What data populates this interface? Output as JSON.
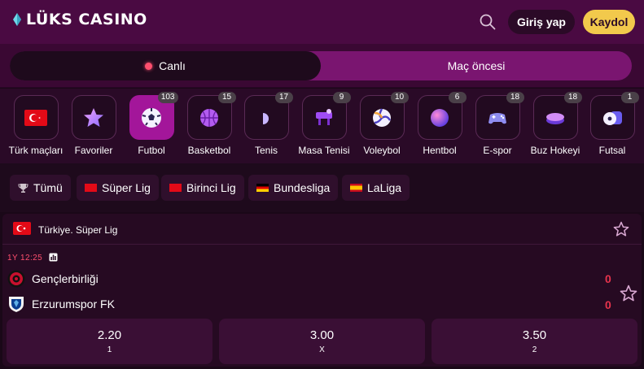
{
  "header": {
    "logo_text": "LÜKS CASINO",
    "login_label": "Giriş yap",
    "register_label": "Kaydol"
  },
  "tabs": [
    {
      "label": "Canlı",
      "active": true
    },
    {
      "label": "Maç öncesi",
      "active": false
    }
  ],
  "sports": [
    {
      "label": "Türk maçları",
      "count": "",
      "icon": "turkey-flag-icon"
    },
    {
      "label": "Favoriler",
      "count": "",
      "icon": "star-icon"
    },
    {
      "label": "Futbol",
      "count": "103",
      "icon": "football-icon",
      "active": true
    },
    {
      "label": "Basketbol",
      "count": "15",
      "icon": "basketball-icon"
    },
    {
      "label": "Tenis",
      "count": "17",
      "icon": "tennis-icon"
    },
    {
      "label": "Masa Tenisi",
      "count": "9",
      "icon": "table-tennis-icon"
    },
    {
      "label": "Voleybol",
      "count": "10",
      "icon": "volleyball-icon"
    },
    {
      "label": "Hentbol",
      "count": "6",
      "icon": "handball-icon"
    },
    {
      "label": "E-spor",
      "count": "18",
      "icon": "gamepad-icon"
    },
    {
      "label": "Buz Hokeyi",
      "count": "18",
      "icon": "hockey-puck-icon"
    },
    {
      "label": "Futsal",
      "count": "1",
      "icon": "futsal-icon"
    }
  ],
  "leagues": [
    {
      "label": "Tümü",
      "icon": "trophy-icon"
    },
    {
      "label": "Süper Lig",
      "icon": "turkey-flag-icon"
    },
    {
      "label": "Birinci Lig",
      "icon": "turkey-flag-icon"
    },
    {
      "label": "Bundesliga",
      "icon": "germany-flag-icon"
    },
    {
      "label": "LaLiga",
      "icon": "spain-flag-icon"
    }
  ],
  "match": {
    "league": "Türkiye. Süper Lig",
    "time": "1Y 12:25",
    "home": {
      "name": "Gençlerbirliği",
      "score": "0"
    },
    "away": {
      "name": "Erzurumspor FK",
      "score": "0"
    },
    "odds": [
      {
        "value": "2.20",
        "label": "1"
      },
      {
        "value": "3.00",
        "label": "X"
      },
      {
        "value": "3.50",
        "label": "2"
      }
    ]
  },
  "colors": {
    "header_bg": "#4a0a42",
    "accent": "#a3169a",
    "register_bg": "#f2c94c",
    "live": "#ff4f6e",
    "score": "#e6334c"
  }
}
